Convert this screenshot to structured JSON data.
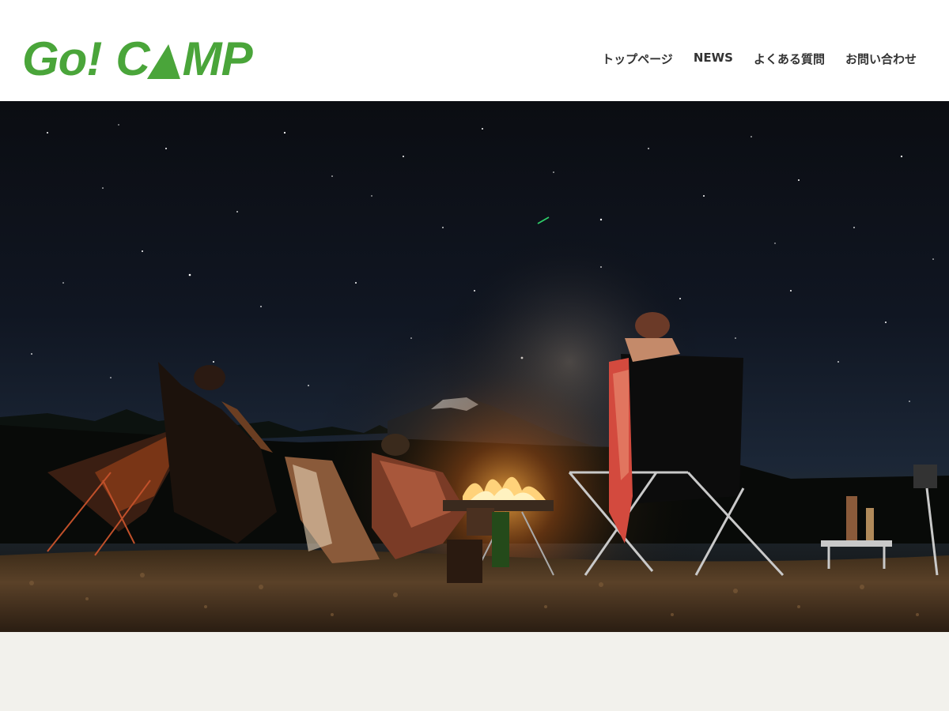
{
  "brand": {
    "logo_part1": "Go!",
    "logo_part2a": "C",
    "logo_part2b": "MP",
    "logo_color": "#4aa53a",
    "logo_triangle_icon": "tent-triangle-icon"
  },
  "nav": {
    "items": [
      {
        "label": "トップページ"
      },
      {
        "label": "NEWS"
      },
      {
        "label": "よくある質問"
      },
      {
        "label": "お問い合わせ"
      }
    ]
  },
  "hero": {
    "image_subject": "night-campfire-stargazing-photo"
  },
  "colors": {
    "header_bg": "#ffffff",
    "nav_text": "#333333",
    "footer_band": "#f2f1ec"
  }
}
